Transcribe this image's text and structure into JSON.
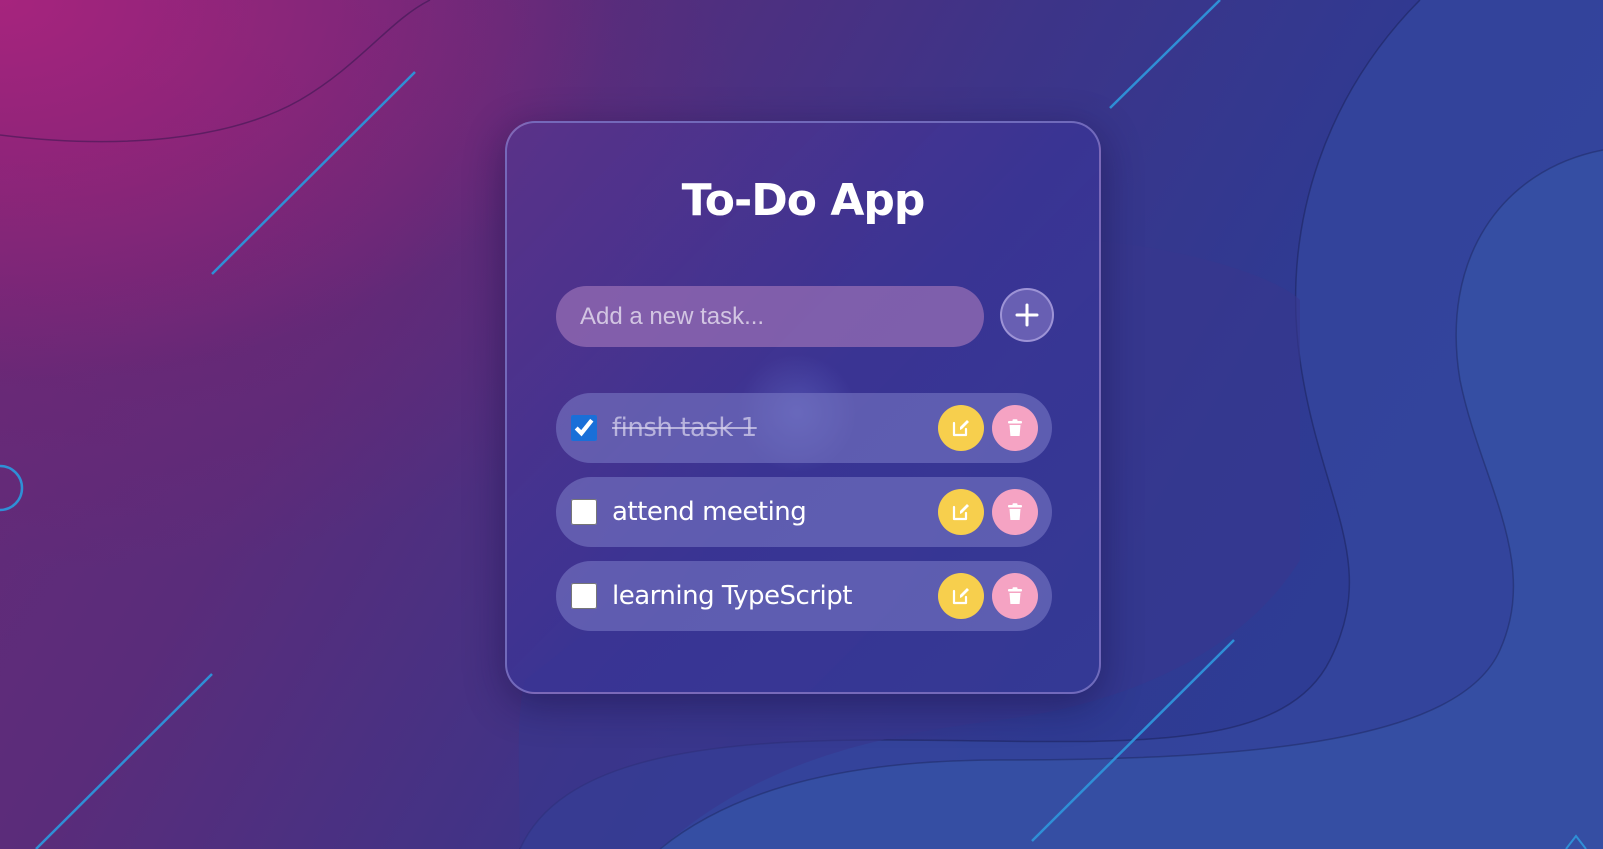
{
  "app": {
    "title": "To-Do App"
  },
  "new_task": {
    "placeholder": "Add a new task...",
    "value": "",
    "add_icon": "plus-icon"
  },
  "tasks": [
    {
      "label": "finsh task 1",
      "completed": true
    },
    {
      "label": "attend meeting",
      "completed": false
    },
    {
      "label": "learning TypeScript",
      "completed": false
    }
  ],
  "task_actions": {
    "edit_icon": "edit-icon",
    "delete_icon": "trash-icon"
  },
  "colors": {
    "edit_button": "#f7cf4d",
    "delete_button": "#f5a3c3",
    "checkbox_accent": "#1a6fd8",
    "text": "#ffffff"
  }
}
